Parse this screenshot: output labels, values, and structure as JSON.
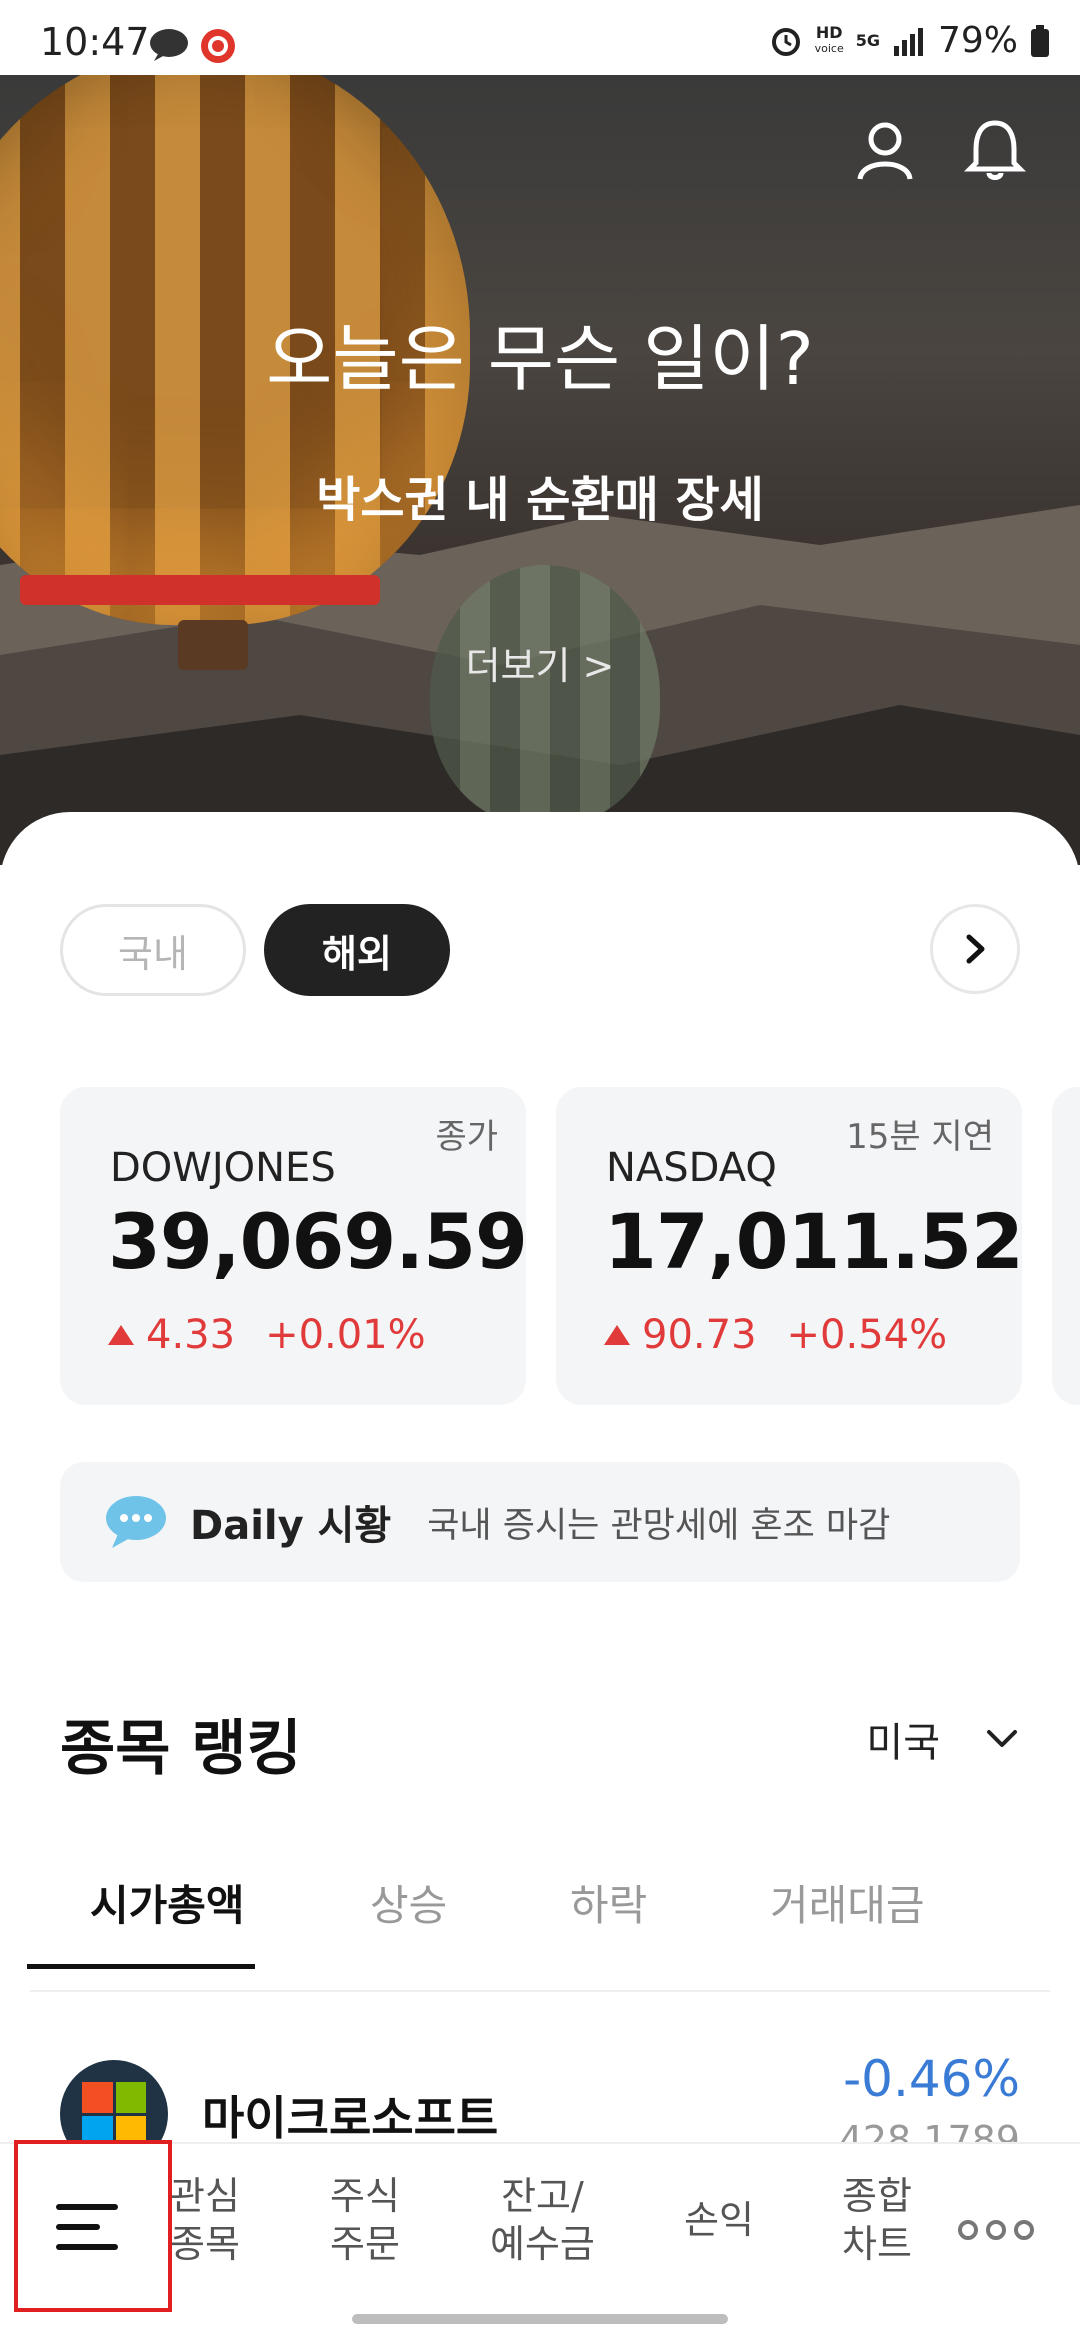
{
  "status_bar": {
    "time": "10:47",
    "hd": "HD",
    "voice": "voice",
    "network": "5G",
    "battery": "79%"
  },
  "hero": {
    "title": "오늘은 무슨 일이?",
    "subtitle": "박스권 내 순환매 장세",
    "more": "더보기 >"
  },
  "market_toggle": {
    "domestic": "국내",
    "overseas": "해외",
    "selected": "해외"
  },
  "index_cards": [
    {
      "tag": "종가",
      "name": "DOWJONES",
      "value": "39,069.59",
      "change": "4.33",
      "pct": "+0.01%"
    },
    {
      "tag": "15분 지연",
      "name": "NASDAQ",
      "value": "17,011.52",
      "change": "90.73",
      "pct": "+0.54%"
    }
  ],
  "daily": {
    "label": "Daily 시황",
    "text": "국내 증시는 관망세에 혼조 마감"
  },
  "ranking": {
    "title": "종목 랭킹",
    "country": "미국",
    "tabs": [
      "시가총액",
      "상승",
      "하락",
      "거래대금"
    ],
    "active_tab": "시가총액",
    "items": [
      {
        "name": "마이크로소프트",
        "pct": "-0.46%",
        "price": "428.1789"
      }
    ]
  },
  "bottom_nav": {
    "items": [
      {
        "line1": "관심",
        "line2": "종목"
      },
      {
        "line1": "주식",
        "line2": "주문"
      },
      {
        "line1": "잔고/",
        "line2": "예수금"
      },
      {
        "line1": "손익",
        "line2": ""
      },
      {
        "line1": "종합",
        "line2": "차트"
      }
    ]
  },
  "colors": {
    "up": "#e03a3a",
    "down": "#3a7bd5",
    "highlight": "#e02020"
  }
}
